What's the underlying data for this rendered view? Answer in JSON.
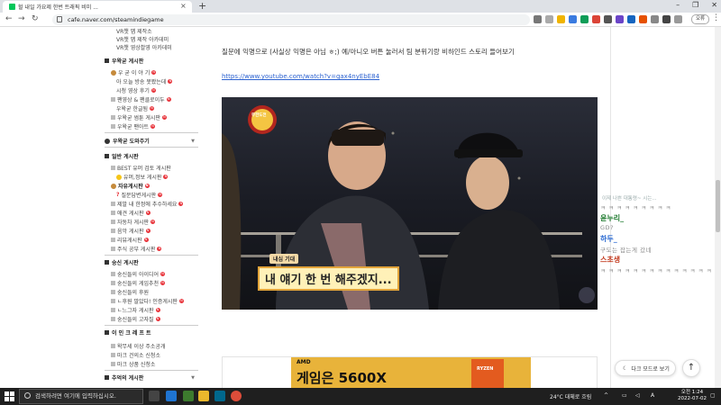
{
  "browser": {
    "tab_title": "헐 내일 가요제 한번 트래픽 비미 ...",
    "url": "cafe.naver.com/steamindiegame",
    "profile_label": "오류"
  },
  "sidebar": {
    "top_items": [
      "VR챗 맵 제작소",
      "VR챗 맵 제작 아카데미",
      "VR챗 영상촬영 아카데미"
    ],
    "groups": [
      {
        "title": "우왁굳 게시판",
        "items": [
          "우 굳 이 야 기",
          "아 오늘 방송 못봤는데",
          "시청 영상 후기",
          "팬영상 & 팬클로이두",
          "우왁굳 한글됨",
          "우왁굳 썸툰 게시판",
          "우왁굳 팬아트"
        ]
      },
      {
        "title": "우왁굳 도와주기",
        "items": []
      },
      {
        "title": "일반 게시판",
        "items": [
          "BEST 유머 검토 게시판",
          "유머,정보 게시판",
          "자유게시판",
          "질문답변게시판",
          "제발 내 한정에 추수하세요",
          "애견 게시판",
          "자동차 게시판",
          "음악 게시판",
          "리뷰게시판",
          "주식 공부 게시판"
        ]
      },
      {
        "title": "숭신 게시판",
        "items": [
          "숭신들의 아이디어",
          "숭신들의 게임추천",
          "숭신들의 후원",
          "ㄴ후원 말았다! 인증게시판",
          "ㄴ느그자 게시판",
          "숭신들의 고자질"
        ]
      },
      {
        "title": "이 인 크 레 프 트",
        "items": [
          "왁무세 이상 주소공개",
          "마크 건의소 신청소",
          "마크 상품 신청소"
        ]
      },
      {
        "title": "추억의 게시판",
        "items": []
      }
    ]
  },
  "post": {
    "text": "질문에 익명으로 (사실상 익명은 아님 ㅎ;) 예/아니오 버튼 눌러서 팀 분위기랑 비하인드 스토리 들어보기",
    "link": "https://www.youtube.com/watch?v=gax4nyEbE84",
    "video": {
      "logo_text": "무한도전",
      "caption_tag": "내심 기대",
      "caption": "내 얘기 한 번 해주겠지..."
    },
    "ad": {
      "brand": "AMD",
      "sub": "RYZEN",
      "headline": "게임은 5600X"
    }
  },
  "chat": {
    "faint_line": "이제 나쁜 대통령~ 시는...",
    "entries": [
      {
        "name": "",
        "msg": "ㅋ ㅋ ㅋ ㅋ ㅋ ㅋ ㅋ ㅋ ㅋ",
        "name_color": "#1e7a2e"
      },
      {
        "name": "윤누리_",
        "msg": "GD?",
        "name_color": "#1e7a2e"
      },
      {
        "name": "하두_",
        "msg": "구도는 잡는게 갔네",
        "name_color": "#2b6ad2"
      },
      {
        "name": "스초생",
        "msg": "ㅋ ㅋ ㅋ ㅋ ㅋ ㅋ ㅋ ㅋ ㅋ ㅋ ㅋ ㅋ ㅋ ㅋ ㅋ",
        "name_color": "#c23a1e"
      }
    ]
  },
  "floating": {
    "dark_mode_label": "다크 모드로 보기",
    "top_icon": "arrow-up-icon"
  },
  "taskbar": {
    "search_placeholder": "검색하려면 여기에 입력하십시오.",
    "weather": "24°C 대체로 흐림",
    "ime": "A",
    "time": "오전 1:24",
    "date": "2022-07-02"
  }
}
